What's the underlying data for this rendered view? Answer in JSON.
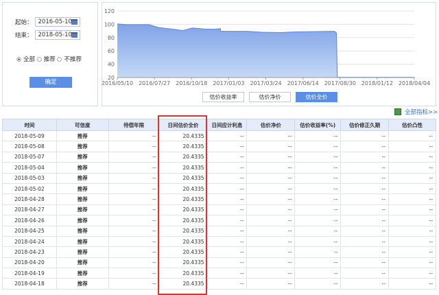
{
  "filters": {
    "start_label": "起始：",
    "start_value": "2016-05-10",
    "end_label": "结束：",
    "end_value": "2018-05-10",
    "radios": [
      {
        "label": "全部",
        "checked": true
      },
      {
        "label": "推荐",
        "checked": false
      },
      {
        "label": "不推荐",
        "checked": false
      }
    ],
    "confirm": "确定"
  },
  "chart_buttons": [
    {
      "label": "估价收益率",
      "active": false
    },
    {
      "label": "估价净价",
      "active": false
    },
    {
      "label": "估价全价",
      "active": true
    }
  ],
  "all_indicators": "全部指标>>",
  "chart_data": {
    "type": "area",
    "ylim": [
      20,
      120
    ],
    "yticks": [
      20,
      40,
      60,
      80,
      100,
      120
    ],
    "xticks": [
      "2016/05/10",
      "2016/07/27",
      "2016/10/18",
      "2017/01/03",
      "2017/03/24",
      "2017/06/14",
      "2017/08/30",
      "2018/01/12",
      "2018/04/04"
    ],
    "x": [
      "2016/05/10",
      "2016/06/01",
      "2016/07/01",
      "2016/07/27",
      "2016/08/20",
      "2016/09/20",
      "2016/10/18",
      "2016/11/10",
      "2016/12/10",
      "2017/01/03",
      "2017/01/18",
      "2017/01/19",
      "2017/03/24",
      "2017/05/01",
      "2017/06/14",
      "2017/07/20",
      "2017/08/30",
      "2017/10/25",
      "2017/10/30",
      "2017/11/01",
      "2018/05/09"
    ],
    "values": [
      100.5,
      99.5,
      99.5,
      99.5,
      95,
      93,
      90.5,
      94.5,
      93,
      92.5,
      93.5,
      89.5,
      89.5,
      88,
      87.5,
      88.5,
      89,
      89.5,
      87,
      20.4,
      20.4
    ],
    "color": "#7fa6e8"
  },
  "table": {
    "headers": [
      "时间",
      "可信度",
      "待偿年限",
      "日间估价全价",
      "日间应计利息",
      "估价净价",
      "估价收益率(%)",
      "估价修正久期",
      "估价凸性"
    ],
    "rows": [
      [
        "2018-05-09",
        "推荐",
        "--",
        "20.4335",
        "--",
        "--",
        "--",
        "--",
        "--"
      ],
      [
        "2018-05-08",
        "推荐",
        "--",
        "20.4335",
        "--",
        "--",
        "--",
        "--",
        "--"
      ],
      [
        "2018-05-07",
        "推荐",
        "--",
        "20.4335",
        "--",
        "--",
        "--",
        "--",
        "--"
      ],
      [
        "2018-05-04",
        "推荐",
        "--",
        "20.4335",
        "--",
        "--",
        "--",
        "--",
        "--"
      ],
      [
        "2018-05-03",
        "推荐",
        "--",
        "20.4335",
        "--",
        "--",
        "--",
        "--",
        "--"
      ],
      [
        "2018-05-02",
        "推荐",
        "--",
        "20.4335",
        "--",
        "--",
        "--",
        "--",
        "--"
      ],
      [
        "2018-04-28",
        "推荐",
        "--",
        "20.4335",
        "--",
        "--",
        "--",
        "--",
        "--"
      ],
      [
        "2018-04-27",
        "推荐",
        "--",
        "20.4335",
        "--",
        "--",
        "--",
        "--",
        "--"
      ],
      [
        "2018-04-26",
        "推荐",
        "--",
        "20.4335",
        "--",
        "--",
        "--",
        "--",
        "--"
      ],
      [
        "2018-04-25",
        "推荐",
        "--",
        "20.4335",
        "--",
        "--",
        "--",
        "--",
        "--"
      ],
      [
        "2018-04-24",
        "推荐",
        "--",
        "20.4335",
        "--",
        "--",
        "--",
        "--",
        "--"
      ],
      [
        "2018-04-23",
        "推荐",
        "--",
        "20.4335",
        "--",
        "--",
        "--",
        "--",
        "--"
      ],
      [
        "2018-04-20",
        "推荐",
        "--",
        "20.4335",
        "--",
        "--",
        "--",
        "--",
        "--"
      ],
      [
        "2018-04-19",
        "推荐",
        "--",
        "20.4335",
        "--",
        "--",
        "--",
        "--",
        "--"
      ],
      [
        "2018-04-18",
        "推荐",
        "--",
        "20.4335",
        "--",
        "--",
        "--",
        "--",
        "--"
      ]
    ]
  }
}
